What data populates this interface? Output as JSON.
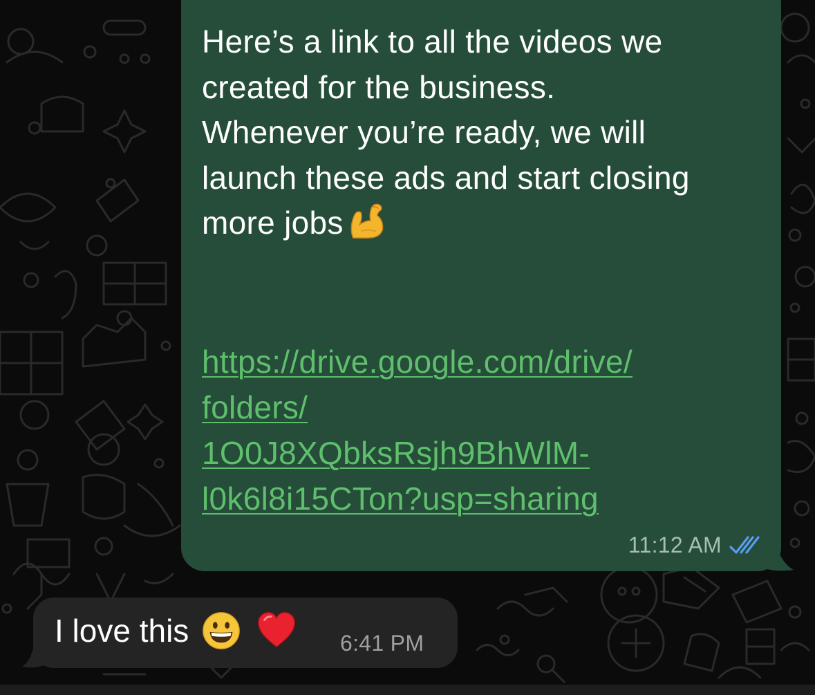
{
  "outgoing_message": {
    "text_lines": [
      "Here’s a link to all the videos we",
      "created for the business.",
      "Whenever you’re ready, we will",
      "launch these ads and start closing",
      "more jobs"
    ],
    "emoji": "flexed-biceps-emoji",
    "link_lines": [
      "https://drive.google.com/drive/",
      "folders/",
      "1O0J8XQbksRsjh9BhWlM-",
      "l0k6l8i15CTon?usp=sharing"
    ],
    "time": "11:12 AM",
    "status_icon": "double-check-read-icon",
    "status_color": "#5b9cf0"
  },
  "incoming_message": {
    "text": "I love this",
    "emojis": [
      "grinning-face-emoji",
      "red-heart-emoji"
    ],
    "time": "6:41 PM"
  },
  "colors": {
    "background": "#0b0b0b",
    "outgoing_bubble": "#254d3a",
    "incoming_bubble": "#242424",
    "link": "#5fbf6d"
  }
}
